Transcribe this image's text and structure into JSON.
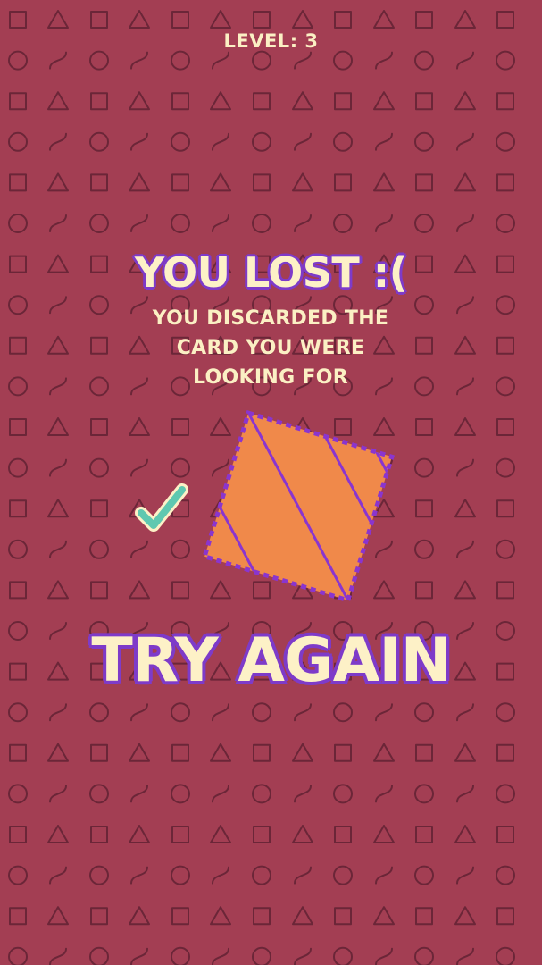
{
  "level_label": "LEVEL: 3",
  "result_title": "YOU LOST :(",
  "result_message": "YOU DISCARDED THE CARD YOU WERE LOOKING FOR",
  "retry_label": "TRY AGAIN",
  "target_card": {
    "color": "#f0894a",
    "stripe_color": "#8a35cf",
    "border_style": "dashed",
    "pattern": "diagonal-stripes"
  },
  "check_icon": "check-icon",
  "colors": {
    "background": "#a33e53",
    "pattern": "#6b2638",
    "text": "#fbf0c4",
    "outline": "#7e3bc9",
    "check": "#5fc8b0"
  }
}
